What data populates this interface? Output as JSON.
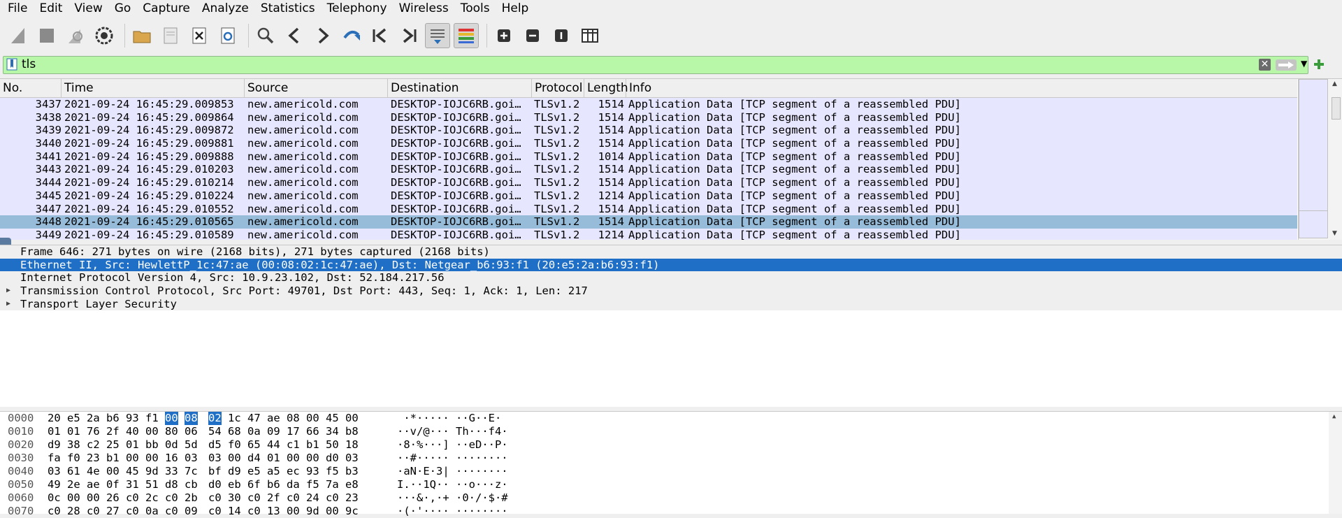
{
  "menu": [
    "File",
    "Edit",
    "View",
    "Go",
    "Capture",
    "Analyze",
    "Statistics",
    "Telephony",
    "Wireless",
    "Tools",
    "Help"
  ],
  "filter": {
    "value": "tls"
  },
  "columns": [
    "No.",
    "Time",
    "Source",
    "Destination",
    "Protocol",
    "Length",
    "Info"
  ],
  "packets": [
    {
      "no": "3437",
      "time": "2021-09-24 16:45:29.009853",
      "src": "new.americold.com",
      "dst": "DESKTOP-IOJC6RB.goi…",
      "proto": "TLSv1.2",
      "len": "1514",
      "info": "Application Data [TCP segment of a reassembled PDU]"
    },
    {
      "no": "3438",
      "time": "2021-09-24 16:45:29.009864",
      "src": "new.americold.com",
      "dst": "DESKTOP-IOJC6RB.goi…",
      "proto": "TLSv1.2",
      "len": "1514",
      "info": "Application Data [TCP segment of a reassembled PDU]"
    },
    {
      "no": "3439",
      "time": "2021-09-24 16:45:29.009872",
      "src": "new.americold.com",
      "dst": "DESKTOP-IOJC6RB.goi…",
      "proto": "TLSv1.2",
      "len": "1514",
      "info": "Application Data [TCP segment of a reassembled PDU]"
    },
    {
      "no": "3440",
      "time": "2021-09-24 16:45:29.009881",
      "src": "new.americold.com",
      "dst": "DESKTOP-IOJC6RB.goi…",
      "proto": "TLSv1.2",
      "len": "1514",
      "info": "Application Data [TCP segment of a reassembled PDU]"
    },
    {
      "no": "3441",
      "time": "2021-09-24 16:45:29.009888",
      "src": "new.americold.com",
      "dst": "DESKTOP-IOJC6RB.goi…",
      "proto": "TLSv1.2",
      "len": "1014",
      "info": "Application Data [TCP segment of a reassembled PDU]"
    },
    {
      "no": "3443",
      "time": "2021-09-24 16:45:29.010203",
      "src": "new.americold.com",
      "dst": "DESKTOP-IOJC6RB.goi…",
      "proto": "TLSv1.2",
      "len": "1514",
      "info": "Application Data [TCP segment of a reassembled PDU]"
    },
    {
      "no": "3444",
      "time": "2021-09-24 16:45:29.010214",
      "src": "new.americold.com",
      "dst": "DESKTOP-IOJC6RB.goi…",
      "proto": "TLSv1.2",
      "len": "1514",
      "info": "Application Data [TCP segment of a reassembled PDU]"
    },
    {
      "no": "3445",
      "time": "2021-09-24 16:45:29.010224",
      "src": "new.americold.com",
      "dst": "DESKTOP-IOJC6RB.goi…",
      "proto": "TLSv1.2",
      "len": "1214",
      "info": "Application Data [TCP segment of a reassembled PDU]"
    },
    {
      "no": "3447",
      "time": "2021-09-24 16:45:29.010552",
      "src": "new.americold.com",
      "dst": "DESKTOP-IOJC6RB.goi…",
      "proto": "TLSv1.2",
      "len": "1514",
      "info": "Application Data [TCP segment of a reassembled PDU]"
    },
    {
      "no": "3448",
      "time": "2021-09-24 16:45:29.010565",
      "src": "new.americold.com",
      "dst": "DESKTOP-IOJC6RB.goi…",
      "proto": "TLSv1.2",
      "len": "1514",
      "info": "Application Data [TCP segment of a reassembled PDU]",
      "selected": true
    },
    {
      "no": "3449",
      "time": "2021-09-24 16:45:29.010589",
      "src": "new.americold.com",
      "dst": "DESKTOP-IOJC6RB.goi…",
      "proto": "TLSv1.2",
      "len": "1214",
      "info": "Application Data [TCP segment of a reassembled PDU]"
    }
  ],
  "details": [
    {
      "text": "Frame 646: 271 bytes on wire (2168 bits), 271 bytes captured (2168 bits)",
      "expandable": false
    },
    {
      "text": "Ethernet II, Src: HewlettP_1c:47:ae (00:08:02:1c:47:ae), Dst: Netgear_b6:93:f1 (20:e5:2a:b6:93:f1)",
      "expandable": false,
      "selected": true
    },
    {
      "text": "Internet Protocol Version 4, Src: 10.9.23.102, Dst: 52.184.217.56",
      "expandable": false
    },
    {
      "text": "Transmission Control Protocol, Src Port: 49701, Dst Port: 443, Seq: 1, Ack: 1, Len: 217",
      "expandable": true
    },
    {
      "text": "Transport Layer Security",
      "expandable": true
    }
  ],
  "hex": [
    {
      "offset": "0000",
      "bytes": [
        "20",
        "e5",
        "2a",
        "b6",
        "93",
        "f1",
        "00",
        "08",
        "02",
        "1c",
        "47",
        "ae",
        "08",
        "00",
        "45",
        "00"
      ],
      "ascii": " ·*····· ··G··E·",
      "hl": [
        6,
        7,
        8
      ]
    },
    {
      "offset": "0010",
      "bytes": [
        "01",
        "01",
        "76",
        "2f",
        "40",
        "00",
        "80",
        "06",
        "54",
        "68",
        "0a",
        "09",
        "17",
        "66",
        "34",
        "b8"
      ],
      "ascii": "··v/@··· Th···f4·",
      "hl": []
    },
    {
      "offset": "0020",
      "bytes": [
        "d9",
        "38",
        "c2",
        "25",
        "01",
        "bb",
        "0d",
        "5d",
        "d5",
        "f0",
        "65",
        "44",
        "c1",
        "b1",
        "50",
        "18"
      ],
      "ascii": "·8·%···] ··eD··P·",
      "hl": []
    },
    {
      "offset": "0030",
      "bytes": [
        "fa",
        "f0",
        "23",
        "b1",
        "00",
        "00",
        "16",
        "03",
        "03",
        "00",
        "d4",
        "01",
        "00",
        "00",
        "d0",
        "03"
      ],
      "ascii": "··#····· ········",
      "hl": []
    },
    {
      "offset": "0040",
      "bytes": [
        "03",
        "61",
        "4e",
        "00",
        "45",
        "9d",
        "33",
        "7c",
        "bf",
        "d9",
        "e5",
        "a5",
        "ec",
        "93",
        "f5",
        "b3"
      ],
      "ascii": "·aN·E·3| ········",
      "hl": []
    },
    {
      "offset": "0050",
      "bytes": [
        "49",
        "2e",
        "ae",
        "0f",
        "31",
        "51",
        "d8",
        "cb",
        "d0",
        "eb",
        "6f",
        "b6",
        "da",
        "f5",
        "7a",
        "e8"
      ],
      "ascii": "I.··1Q·· ··o···z·",
      "hl": []
    },
    {
      "offset": "0060",
      "bytes": [
        "0c",
        "00",
        "00",
        "26",
        "c0",
        "2c",
        "c0",
        "2b",
        "c0",
        "30",
        "c0",
        "2f",
        "c0",
        "24",
        "c0",
        "23"
      ],
      "ascii": "···&·,·+ ·0·/·$·#",
      "hl": []
    },
    {
      "offset": "0070",
      "bytes": [
        "c0",
        "28",
        "c0",
        "27",
        "c0",
        "0a",
        "c0",
        "09",
        "c0",
        "14",
        "c0",
        "13",
        "00",
        "9d",
        "00",
        "9c"
      ],
      "ascii": "·(·'···· ········",
      "hl": []
    }
  ]
}
